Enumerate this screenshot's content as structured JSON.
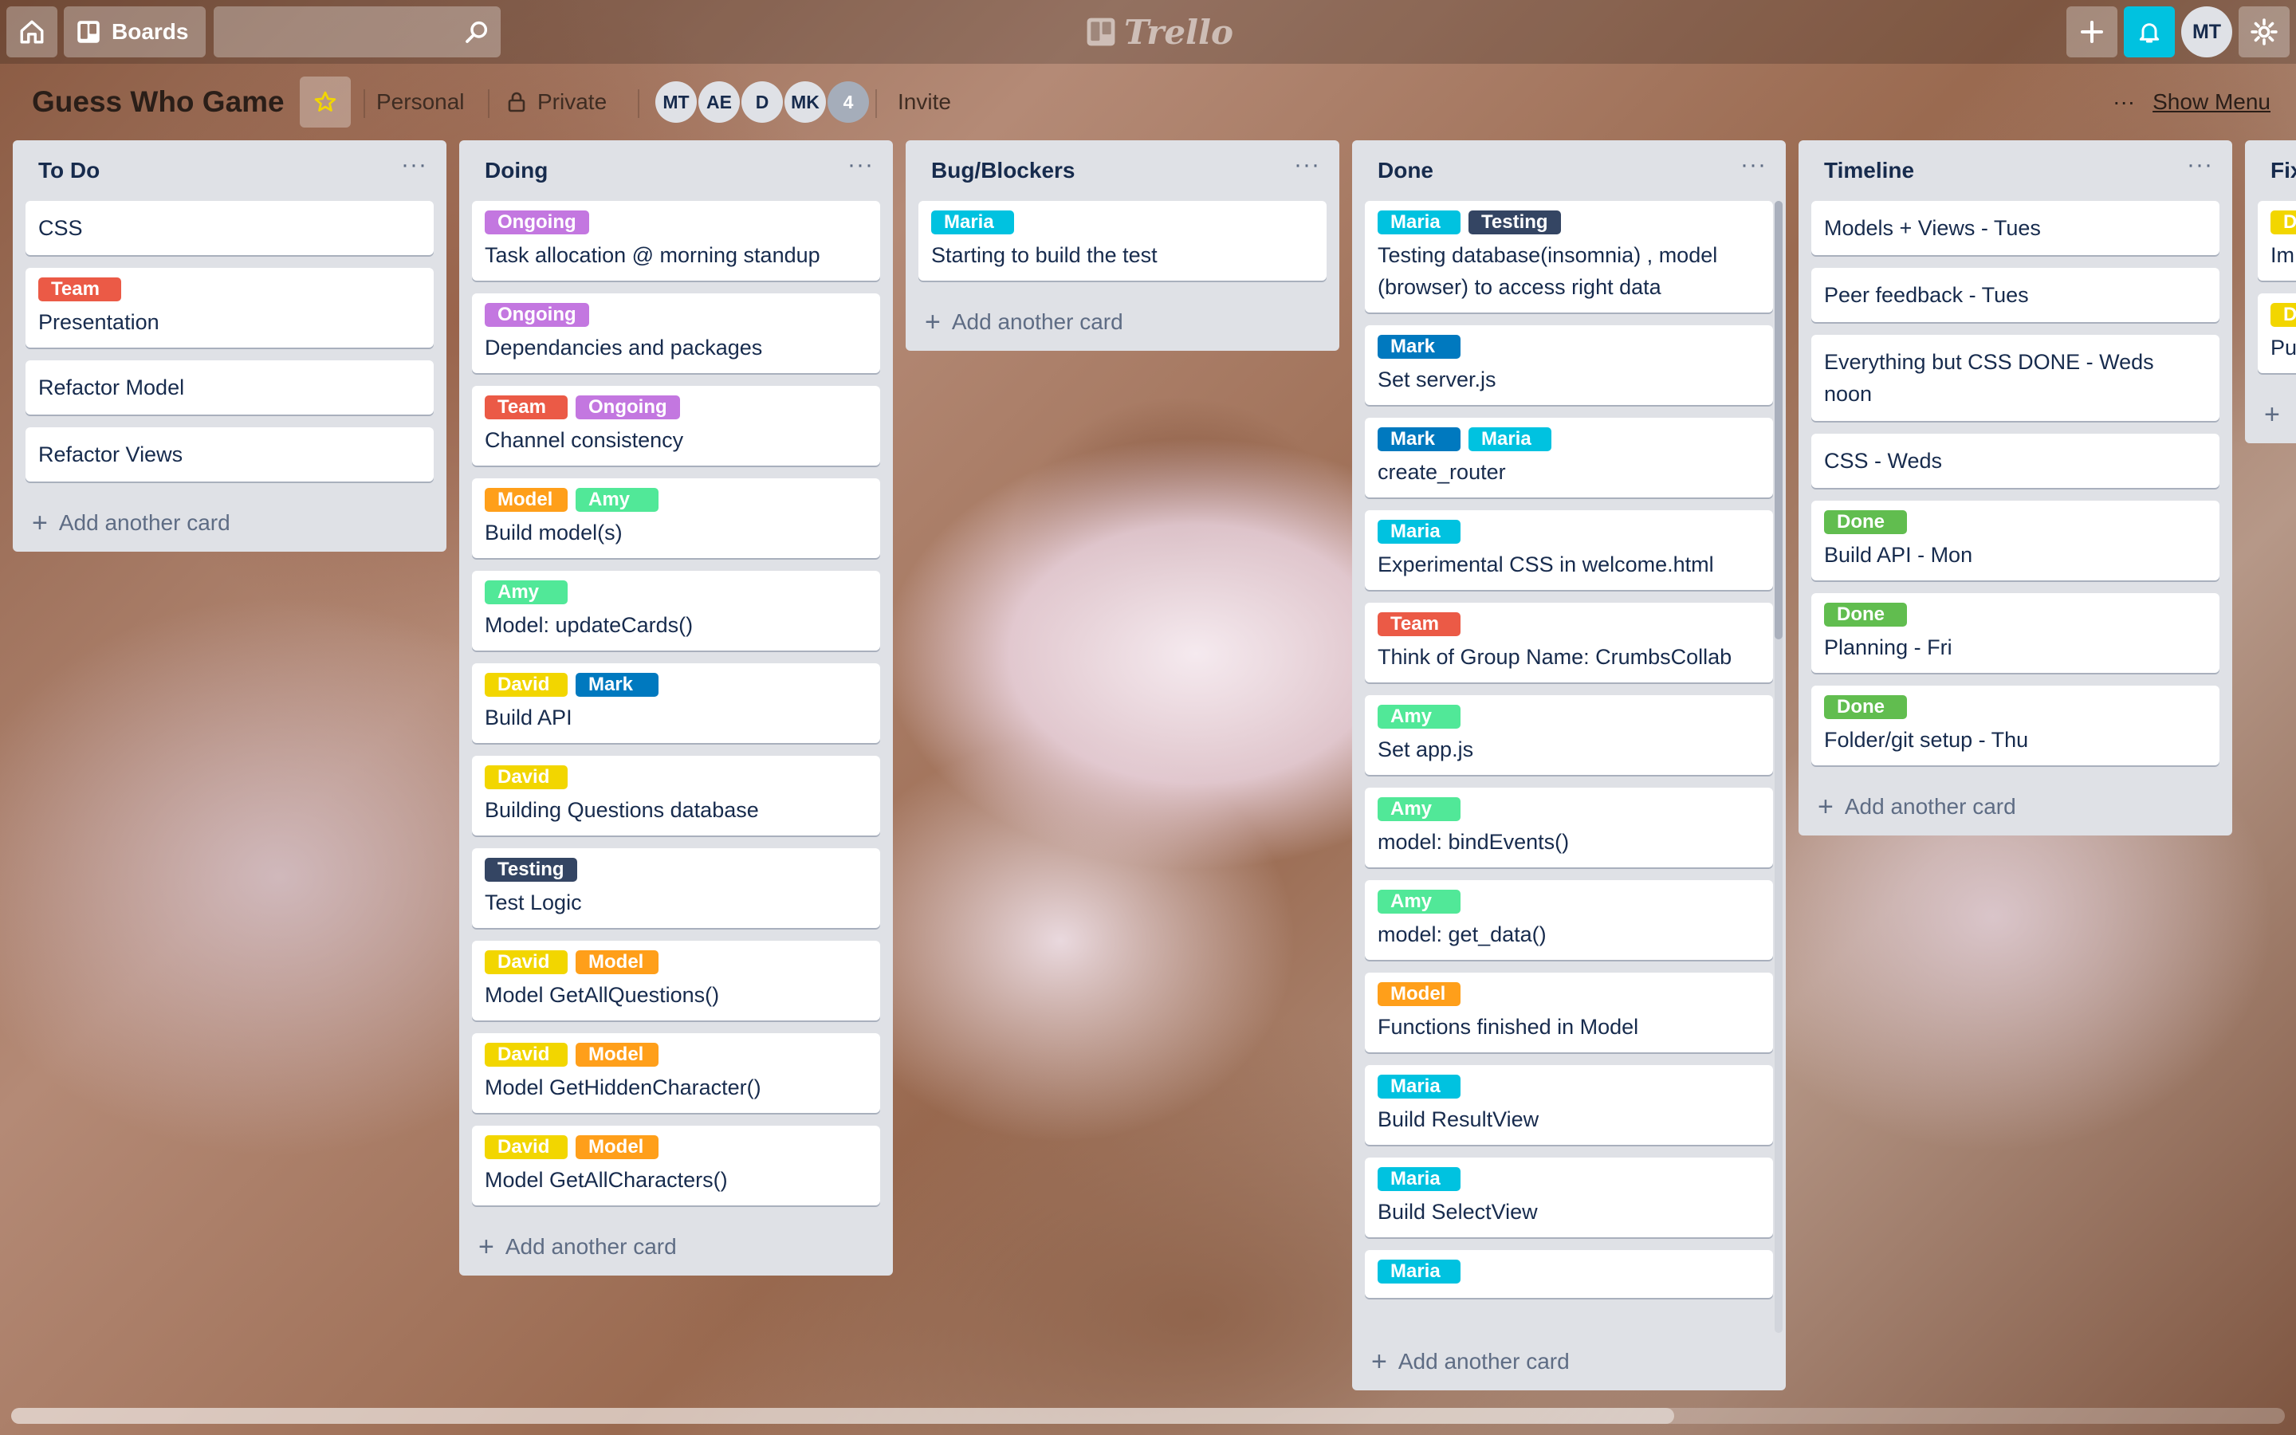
{
  "header": {
    "boards_label": "Boards",
    "search_value": "",
    "logo_text": "Trello",
    "user_initials": "MT"
  },
  "board": {
    "title": "Guess Who Game",
    "team_visibility": "Personal",
    "privacy": "Private",
    "members": [
      "MT",
      "AE",
      "D",
      "MK"
    ],
    "member_overflow": "4",
    "invite_label": "Invite",
    "show_menu_dots": "···",
    "show_menu_label": "Show Menu"
  },
  "label_colors": {
    "Team": "#eb5a46",
    "Ongoing": "#c377e0",
    "Model": "#ff9f1a",
    "Amy": "#51e898",
    "David": "#f2d600",
    "Mark": "#0079bf",
    "Testing": "#344563",
    "Maria": "#00c2e0",
    "Done": "#61bd4f"
  },
  "lists": [
    {
      "title": "To Do",
      "menu": "···",
      "add_label": "Add another card",
      "cards": [
        {
          "labels": [],
          "title": "CSS"
        },
        {
          "labels": [
            "Team"
          ],
          "title": "Presentation"
        },
        {
          "labels": [],
          "title": "Refactor Model"
        },
        {
          "labels": [],
          "title": "Refactor Views"
        }
      ]
    },
    {
      "title": "Doing",
      "menu": "···",
      "add_label": "Add another card",
      "cards": [
        {
          "labels": [
            "Ongoing"
          ],
          "title": "Task allocation @ morning standup"
        },
        {
          "labels": [
            "Ongoing"
          ],
          "title": "Dependancies and packages"
        },
        {
          "labels": [
            "Team",
            "Ongoing"
          ],
          "title": "Channel consistency"
        },
        {
          "labels": [
            "Model",
            "Amy"
          ],
          "title": "Build model(s)"
        },
        {
          "labels": [
            "Amy"
          ],
          "title": "Model: updateCards()"
        },
        {
          "labels": [
            "David",
            "Mark"
          ],
          "title": "Build API"
        },
        {
          "labels": [
            "David"
          ],
          "title": "Building Questions database"
        },
        {
          "labels": [
            "Testing"
          ],
          "title": "Test Logic"
        },
        {
          "labels": [
            "David",
            "Model"
          ],
          "title": "Model GetAllQuestions()"
        },
        {
          "labels": [
            "David",
            "Model"
          ],
          "title": "Model GetHiddenCharacter()"
        },
        {
          "labels": [
            "David",
            "Model"
          ],
          "title": "Model GetAllCharacters()"
        }
      ]
    },
    {
      "title": "Bug/Blockers",
      "menu": "···",
      "add_label": "Add another card",
      "cards": [
        {
          "labels": [
            "Maria"
          ],
          "title": "Starting to build the test"
        }
      ]
    },
    {
      "title": "Done",
      "menu": "···",
      "add_label": "Add another card",
      "cards": [
        {
          "labels": [
            "Maria",
            "Testing"
          ],
          "title": "Testing database(insomnia) , model (browser) to access right data"
        },
        {
          "labels": [
            "Mark"
          ],
          "title": "Set server.js"
        },
        {
          "labels": [
            "Mark",
            "Maria"
          ],
          "title": "create_router"
        },
        {
          "labels": [
            "Maria"
          ],
          "title": "Experimental CSS in welcome.html"
        },
        {
          "labels": [
            "Team"
          ],
          "title": "Think of Group Name: CrumbsCollab"
        },
        {
          "labels": [
            "Amy"
          ],
          "title": "Set app.js"
        },
        {
          "labels": [
            "Amy"
          ],
          "title": "model: bindEvents()"
        },
        {
          "labels": [
            "Amy"
          ],
          "title": "model: get_data()"
        },
        {
          "labels": [
            "Model"
          ],
          "title": "Functions finished in Model"
        },
        {
          "labels": [
            "Maria"
          ],
          "title": "Build ResultView"
        },
        {
          "labels": [
            "Maria"
          ],
          "title": "Build SelectView"
        },
        {
          "labels": [
            "Maria"
          ],
          "title": ""
        }
      ]
    },
    {
      "title": "Timeline",
      "menu": "···",
      "add_label": "Add another card",
      "cards": [
        {
          "labels": [],
          "title": "Models + Views - Tues"
        },
        {
          "labels": [],
          "title": "Peer feedback - Tues"
        },
        {
          "labels": [],
          "title": "Everything but CSS DONE - Weds noon"
        },
        {
          "labels": [],
          "title": "CSS - Weds"
        },
        {
          "labels": [
            "Done"
          ],
          "title": "Build API - Mon"
        },
        {
          "labels": [
            "Done"
          ],
          "title": "Planning - Fri"
        },
        {
          "labels": [
            "Done"
          ],
          "title": "Folder/git setup - Thu"
        }
      ]
    },
    {
      "title": "Fix",
      "menu": "",
      "add_label": "+",
      "cards": [
        {
          "labels": [
            "D"
          ],
          "title": "Im"
        },
        {
          "labels": [
            "D"
          ],
          "title": "Pu"
        }
      ]
    }
  ]
}
